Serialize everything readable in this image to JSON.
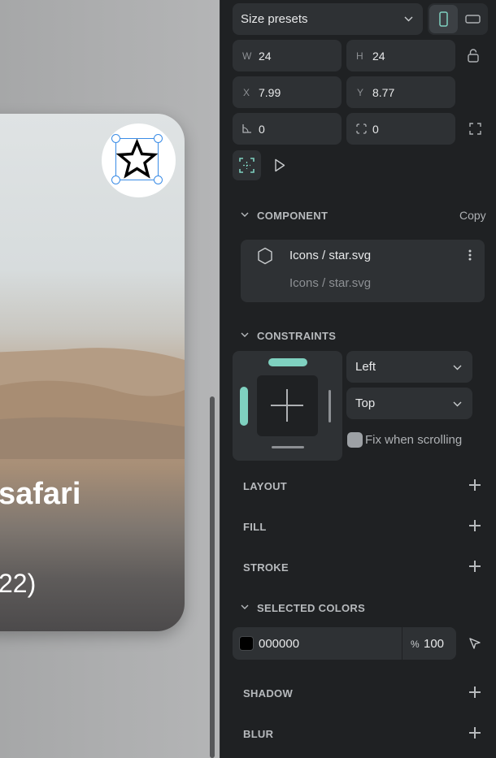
{
  "canvas": {
    "card_title": "safari",
    "card_subtitle": "22)"
  },
  "panel": {
    "size_presets": {
      "label": "Size presets"
    },
    "measures": {
      "w_label": "W",
      "w_value": "24",
      "h_label": "H",
      "h_value": "24",
      "x_label": "X",
      "x_value": "7.99",
      "y_label": "Y",
      "y_value": "8.77",
      "rotation_value": "0",
      "radius_value": "0"
    },
    "component": {
      "title": "COMPONENT",
      "action": "Copy",
      "name": "Icons / star.svg",
      "path": "Icons / star.svg"
    },
    "constraints": {
      "title": "CONSTRAINTS",
      "horizontal": "Left",
      "vertical": "Top",
      "fix_when_scrolling": "Fix when scrolling"
    },
    "sections": {
      "layout": "LAYOUT",
      "fill": "FILL",
      "stroke": "STROKE",
      "selected_colors": "SELECTED COLORS",
      "shadow": "SHADOW",
      "blur": "BLUR"
    },
    "color_row": {
      "hex": "000000",
      "opacity_symbol": "%",
      "opacity": "100",
      "swatch_color": "#000000"
    }
  },
  "colors": {
    "accent": "#7fd1c0",
    "panel_bg": "#1f2123",
    "field_bg": "#2e3134",
    "selection": "#3a8ce6"
  }
}
